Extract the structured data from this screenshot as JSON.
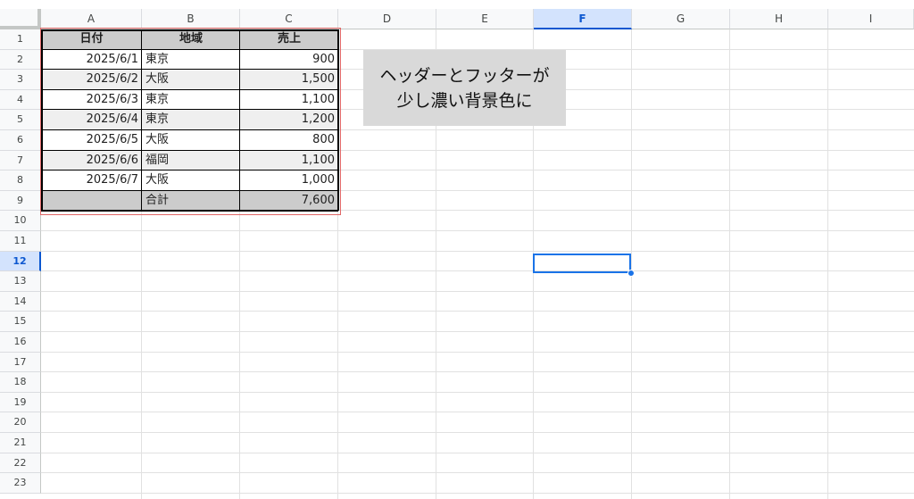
{
  "columns": [
    "A",
    "B",
    "C",
    "D",
    "E",
    "F",
    "G",
    "H",
    "I"
  ],
  "selected_column": "F",
  "rows": [
    "1",
    "2",
    "3",
    "4",
    "5",
    "6",
    "7",
    "8",
    "9",
    "10",
    "11",
    "12",
    "13",
    "14",
    "15",
    "16",
    "17",
    "18",
    "19",
    "20",
    "21",
    "22",
    "23"
  ],
  "selected_row": "12",
  "table": {
    "header": [
      "日付",
      "地域",
      "売上"
    ],
    "records": [
      [
        "2025/6/1",
        "東京",
        "900"
      ],
      [
        "2025/6/2",
        "大阪",
        "1,500"
      ],
      [
        "2025/6/3",
        "東京",
        "1,100"
      ],
      [
        "2025/6/4",
        "東京",
        "1,200"
      ],
      [
        "2025/6/5",
        "大阪",
        "800"
      ],
      [
        "2025/6/6",
        "福岡",
        "1,100"
      ],
      [
        "2025/6/7",
        "大阪",
        "1,000"
      ]
    ],
    "footer": [
      "",
      "合計",
      "7,600"
    ]
  },
  "callout": {
    "line1": "ヘッダーとフッターが",
    "line2": "少し濃い背景色に"
  },
  "colors": {
    "header_fill": "#cccccc",
    "footer_fill": "#cccccc",
    "band_fill": "#efefef",
    "selection": "#1a73e8",
    "callout_fill": "#d9d9d9",
    "highlight_frame": "#e06666"
  }
}
